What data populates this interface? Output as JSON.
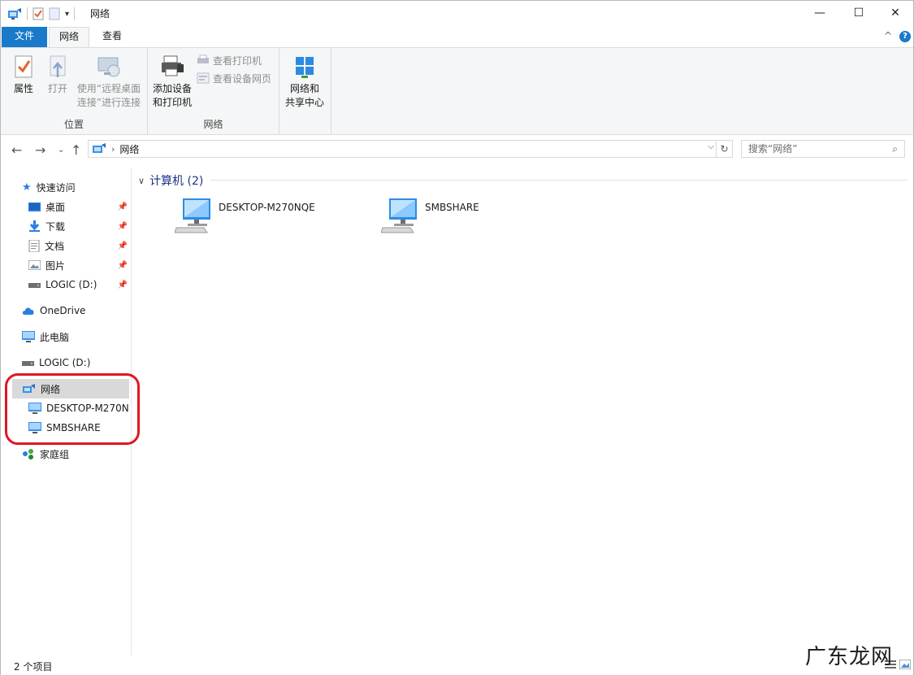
{
  "window": {
    "title": "网络",
    "controls": {
      "minimize": "—",
      "maximize": "☐",
      "close": "✕"
    }
  },
  "ribbon_tabs": [
    {
      "label": "文件"
    },
    {
      "label": "网络"
    },
    {
      "label": "查看"
    }
  ],
  "ribbon": {
    "groups": [
      {
        "label": "位置"
      },
      {
        "label": "网络"
      }
    ],
    "buttons": {
      "properties": "属性",
      "open": "打开",
      "remote_line1": "使用“远程桌面",
      "remote_line2": "连接”进行连接",
      "add_device_line1": "添加设备",
      "add_device_line2": "和打印机",
      "view_printers": "查看打印机",
      "view_device_page": "查看设备网页",
      "sharing_line1": "网络和",
      "sharing_line2": "共享中心"
    },
    "collapse_glyph": "^",
    "help_glyph": "?"
  },
  "address": {
    "crumb": "网络",
    "search_placeholder": "搜索“网络”"
  },
  "nav": {
    "quick_access": "快速访问",
    "desktop": "桌面",
    "downloads": "下载",
    "documents": "文档",
    "pictures": "图片",
    "logic_d_pinned": "LOGIC (D:)",
    "onedrive": "OneDrive",
    "this_pc": "此电脑",
    "logic_d": "LOGIC (D:)",
    "network": "网络",
    "computer1": "DESKTOP-M270N",
    "computer2": "SMBSHARE",
    "homegroup": "家庭组"
  },
  "content": {
    "group_title": "计算机 (2)",
    "computers": [
      {
        "name": "DESKTOP-M270NQE"
      },
      {
        "name": "SMBSHARE"
      }
    ]
  },
  "status": {
    "item_count": "2 个项目"
  },
  "watermark": "广东龙网",
  "colors": {
    "accent": "#1979ca",
    "highlight_ring": "#e0171f",
    "group_title": "#1e3287"
  }
}
